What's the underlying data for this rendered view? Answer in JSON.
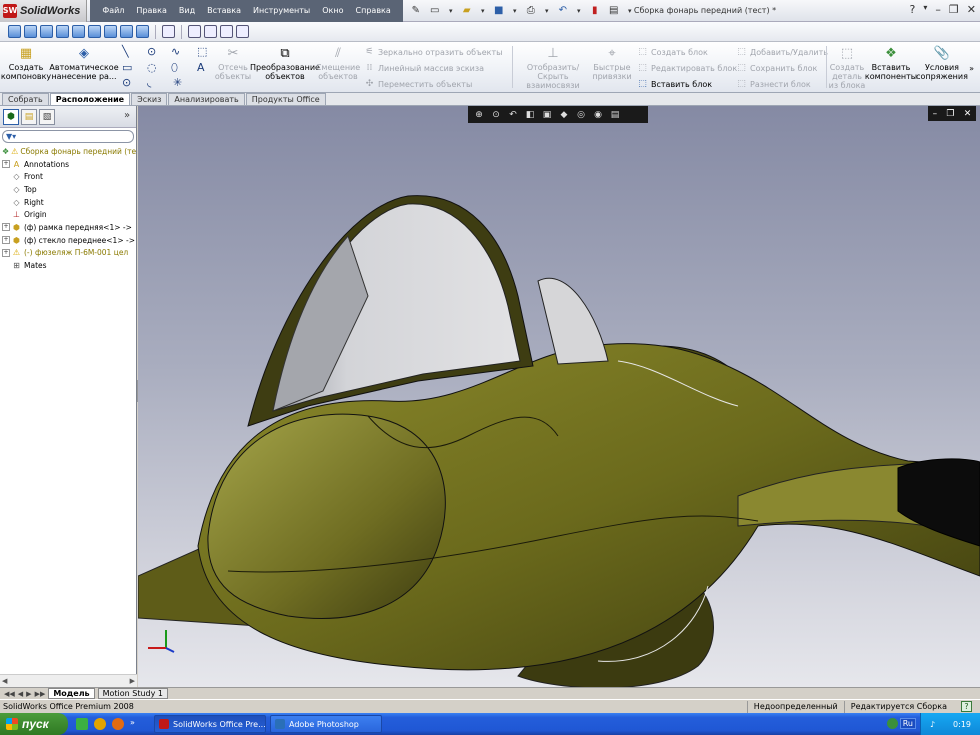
{
  "app": {
    "logo_text": "SolidWorks",
    "doc_title": "Сборка фонарь передний (тест) *",
    "menus": [
      "Файл",
      "Правка",
      "Вид",
      "Вставка",
      "Инструменты",
      "Окно",
      "Справка"
    ]
  },
  "command_manager": {
    "create_layout": "Создать компоновку",
    "auto_annotation": "Автоматическое нанесение ра...",
    "trim_entities": "Отсечь объекты",
    "convert_entities": "Преобразование объектов",
    "offset_entities": "Смещение объектов",
    "mirror_entities": "Зеркально отразить объекты",
    "linear_pattern": "Линейный массив эскиза",
    "move_entities": "Переместить объекты",
    "show_hide_relations": "Отобразить/Скрыть взаимосвязи",
    "quick_snaps": "Быстрые привязки",
    "make_block": "Создать блок",
    "edit_block": "Редактировать блок",
    "insert_block": "Вставить блок",
    "add_remove": "Добавить/Удалить",
    "save_block": "Сохранить блок",
    "explode_block": "Разнести блок",
    "make_part_from_block": "Создать деталь из блока",
    "insert_components": "Вставить компоненты",
    "mate": "Условия сопряжения"
  },
  "tabs": [
    "Собрать",
    "Расположение",
    "Эскиз",
    "Анализировать",
    "Продукты Office"
  ],
  "active_tab": "Расположение",
  "feature_tree": {
    "root": "Сборка фонарь передний (тес",
    "nodes": [
      {
        "label": "Annotations",
        "icon": "annotations-icon",
        "expandable": true
      },
      {
        "label": "Front",
        "icon": "plane-icon",
        "expandable": false
      },
      {
        "label": "Top",
        "icon": "plane-icon",
        "expandable": false
      },
      {
        "label": "Right",
        "icon": "plane-icon",
        "expandable": false
      },
      {
        "label": "Origin",
        "icon": "origin-icon",
        "expandable": false
      },
      {
        "label": "(ф) рамка передняя<1> ->",
        "icon": "part-icon",
        "expandable": true
      },
      {
        "label": "(ф) стекло переднее<1> ->",
        "icon": "part-icon",
        "expandable": true
      },
      {
        "label": "(-) фюзеляж П-6М-001 цел",
        "icon": "warning-part-icon",
        "expandable": true,
        "warning": true
      },
      {
        "label": "Mates",
        "icon": "mates-icon",
        "expandable": false
      }
    ]
  },
  "bottom_tabs": [
    "Модель",
    "Motion Study 1"
  ],
  "status": {
    "left": "SolidWorks Office Premium 2008",
    "state": "Недоопределенный",
    "mode": "Редактируется Сборка"
  },
  "taskbar": {
    "start": "пуск",
    "tasks": [
      "SolidWorks Office Pre...",
      "Adobe Photoshop"
    ],
    "lang": "Ru",
    "clock": "0:19"
  },
  "colors": {
    "model_body": "#6f6d1e",
    "canopy": "#c9c9cc",
    "viewport_top": "#858aa4"
  }
}
